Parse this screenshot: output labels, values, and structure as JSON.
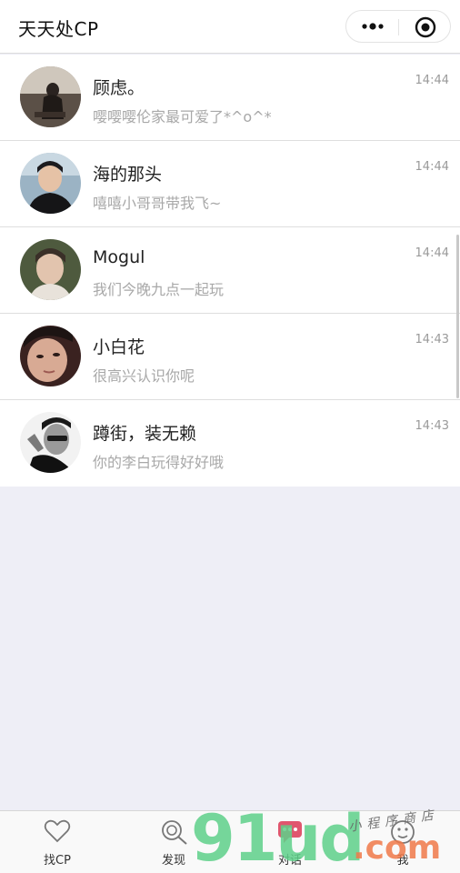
{
  "header": {
    "title": "天天处CP",
    "more_icon": "more-dots-icon",
    "close_icon": "target-circle-icon"
  },
  "chats": [
    {
      "name": "顾虑。",
      "message": "嘤嘤嘤伦家最可爱了*^o^*",
      "time": "14:44",
      "avatar": "photo-person-sitting"
    },
    {
      "name": "海的那头",
      "message": "嘻嘻小哥哥带我飞~",
      "time": "14:44",
      "avatar": "photo-young-man-dark-shirt"
    },
    {
      "name": "Mogul",
      "message": "我们今晚九点一起玩",
      "time": "14:44",
      "avatar": "photo-boy-portrait"
    },
    {
      "name": "小白花",
      "message": "很高兴认识你呢",
      "time": "14:43",
      "avatar": "photo-young-man-closeup"
    },
    {
      "name": "蹲街，装无赖",
      "message": "你的李白玩得好好哦",
      "time": "14:43",
      "avatar": "photo-bw-peace-sign"
    }
  ],
  "tabbar": {
    "tabs": [
      {
        "label": "找CP",
        "icon": "heart-icon"
      },
      {
        "label": "发现",
        "icon": "discover-search-icon"
      },
      {
        "label": "对话",
        "icon": "chat-bubble-icon"
      },
      {
        "label": "我",
        "icon": "smiley-face-icon"
      }
    ]
  },
  "watermark": {
    "brand": "91ud",
    "domain": ".com",
    "tagline": "小程序商店"
  },
  "colors": {
    "background": "#eeeef6",
    "header_bg": "#ffffff",
    "text_primary": "#222222",
    "text_secondary": "#a8a8a8",
    "time": "#9a9a9a",
    "watermark_green": "#5fd18a",
    "watermark_orange": "#f07a4a"
  }
}
